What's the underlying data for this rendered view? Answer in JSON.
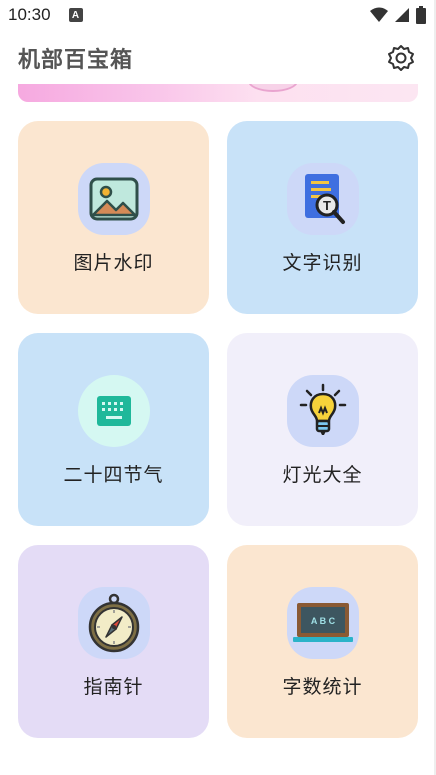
{
  "status_bar": {
    "time": "10:30",
    "badge": "A"
  },
  "app_bar": {
    "title": "机部百宝箱",
    "settings_icon": "gear-icon"
  },
  "tools": [
    {
      "label": "图片水印",
      "bg": "#fbe6d0",
      "icon_bg": "#cdd8f8",
      "icon": "image-icon"
    },
    {
      "label": "文字识别",
      "bg": "#c8e2f8",
      "icon_bg": "#cdd8f8",
      "icon": "document-search-icon"
    },
    {
      "label": "二十四节气",
      "bg": "#c8e2f8",
      "icon_bg": "#d5f8f2",
      "icon": "keyboard-icon"
    },
    {
      "label": "灯光大全",
      "bg": "#f1effa",
      "icon_bg": "#cdd8f8",
      "icon": "lightbulb-icon"
    },
    {
      "label": "指南针",
      "bg": "#e4dcf6",
      "icon_bg": "#cdd8f8",
      "icon": "compass-icon"
    },
    {
      "label": "字数统计",
      "bg": "#fbe6d0",
      "icon_bg": "#cdd8f8",
      "icon": "chalkboard-icon"
    }
  ],
  "chalkboard_text": "A B C"
}
